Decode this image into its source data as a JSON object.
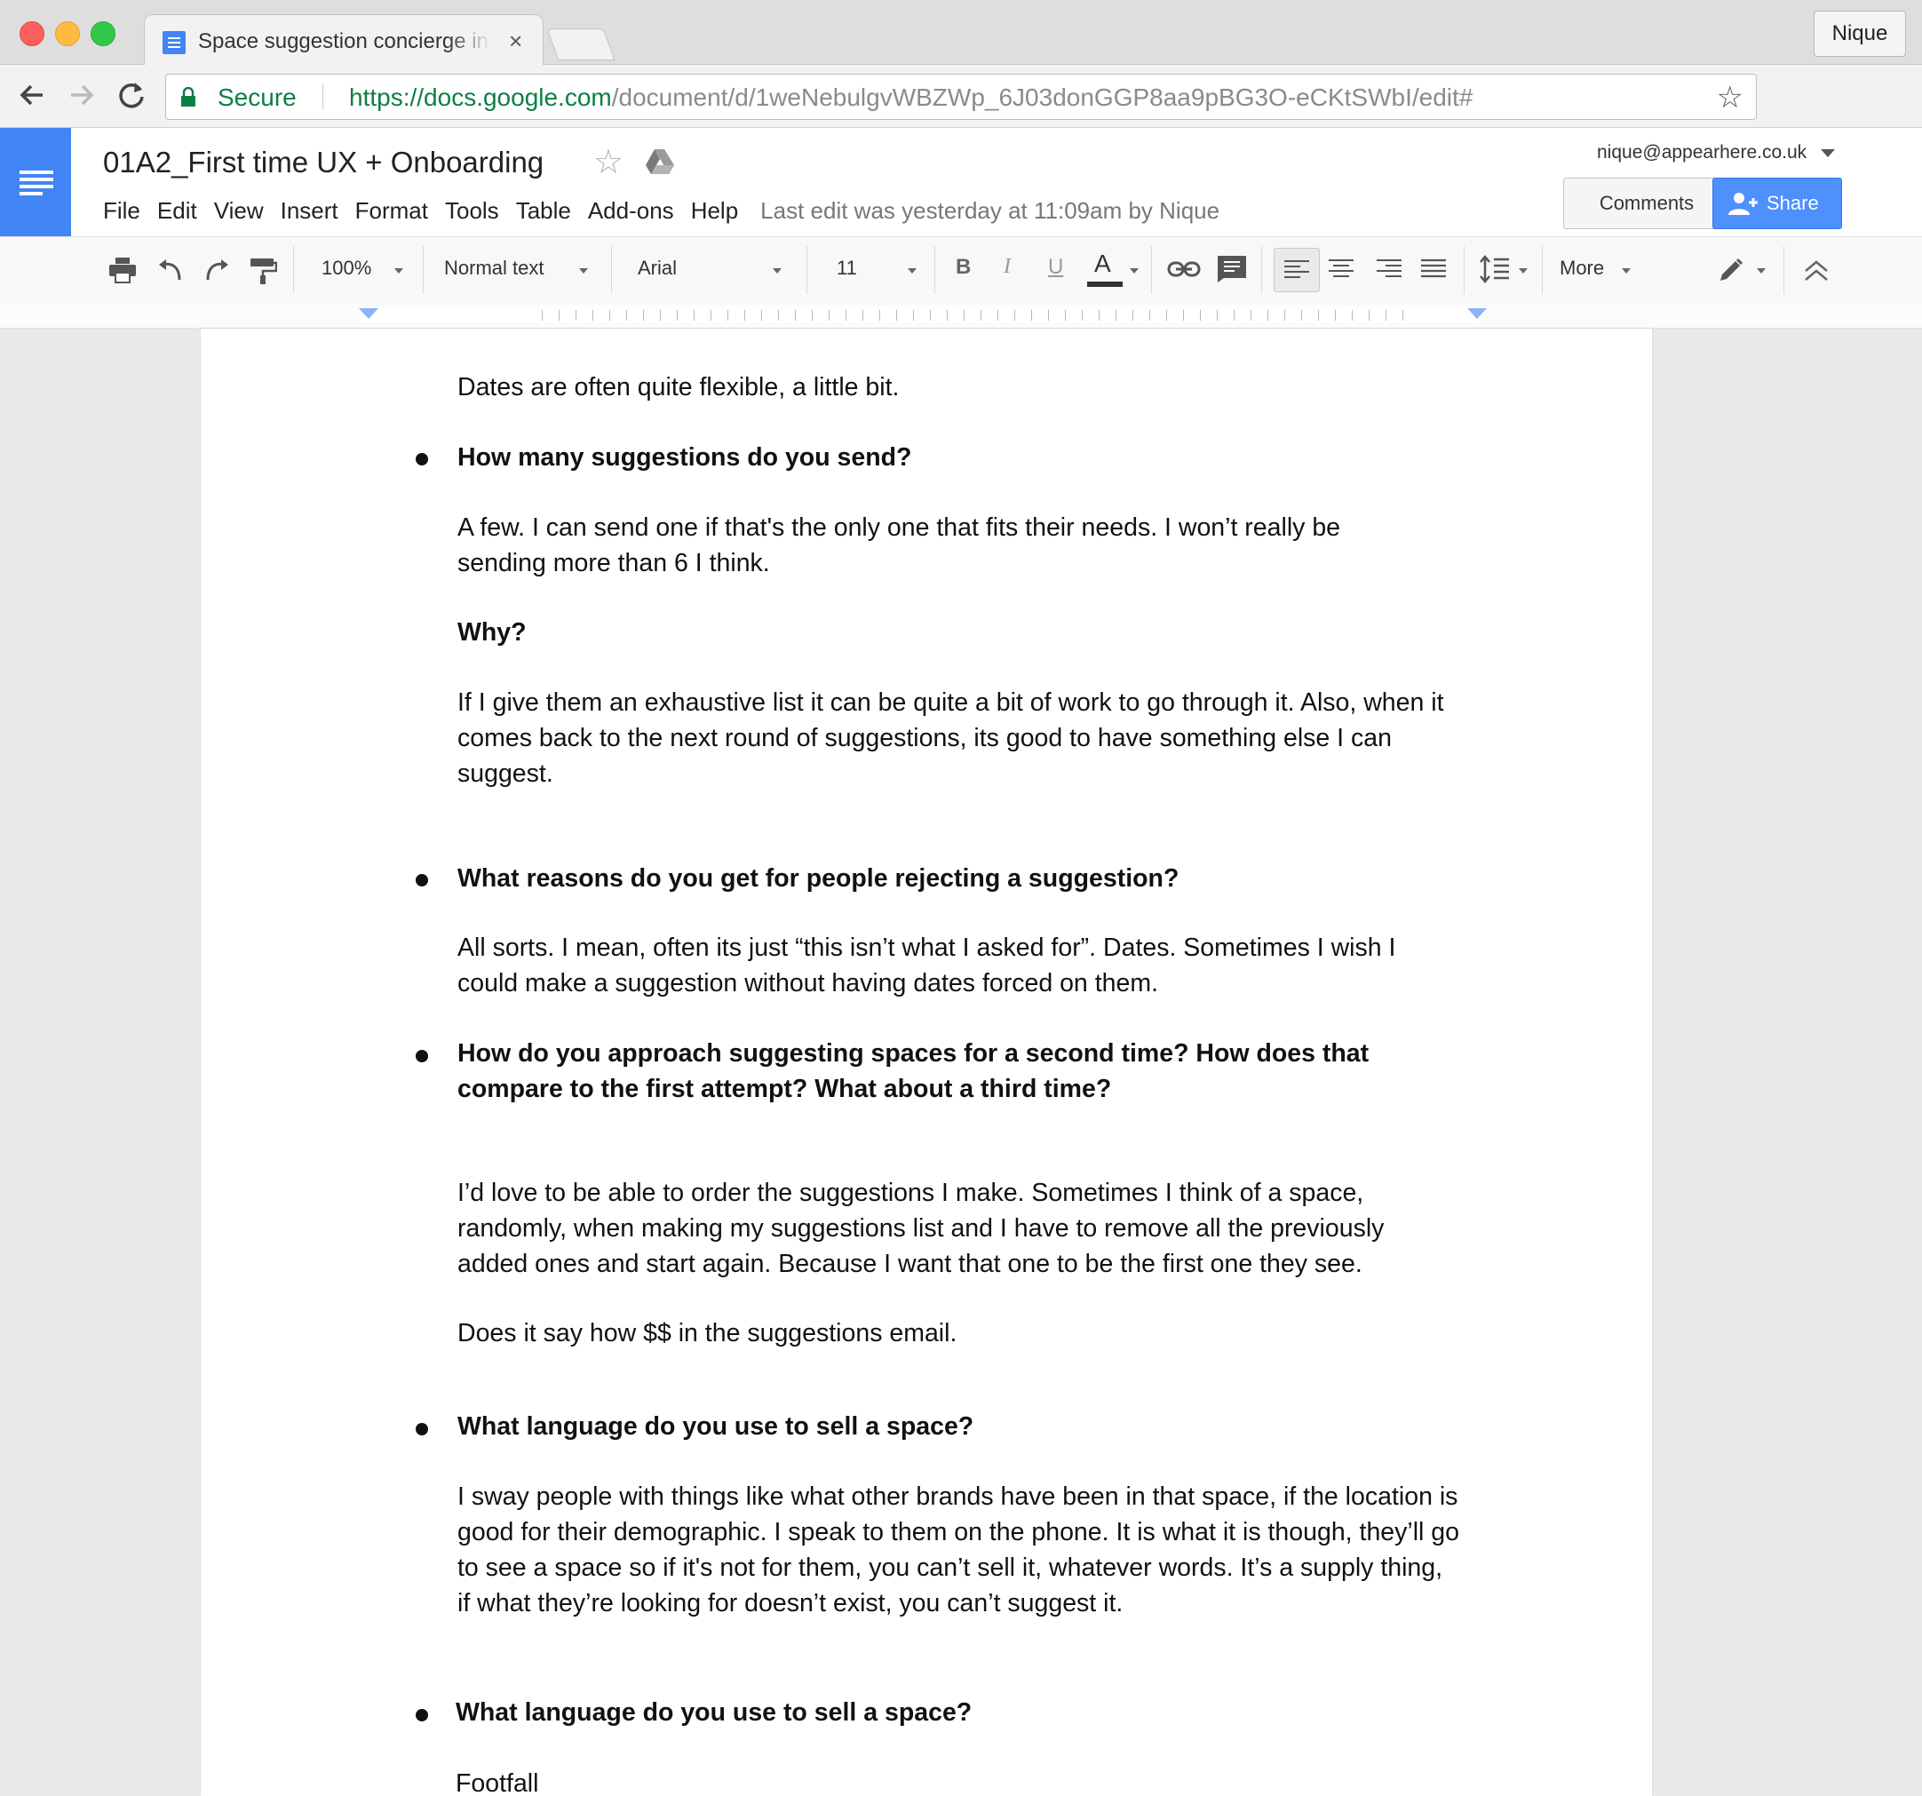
{
  "browser": {
    "tab_title": "Space suggestion concierge interview",
    "tab_close": "×",
    "profile_name": "Nique",
    "secure_label": "Secure",
    "url_scheme": "https://",
    "url_host": "docs.google.com",
    "url_path": "/document/d/1weNebulgvWBZWp_6J03donGGP8aa9pBG3O-eCKtSWbI/edit#"
  },
  "docs": {
    "title": "01A2_First time UX + Onboarding",
    "menus": [
      "File",
      "Edit",
      "View",
      "Insert",
      "Format",
      "Tools",
      "Table",
      "Add-ons",
      "Help"
    ],
    "last_edit": "Last edit was yesterday at 11:09am by Nique",
    "account": "nique@appearhere.co.uk",
    "comments_label": "Comments",
    "share_label": "Share"
  },
  "toolbar": {
    "zoom": "100%",
    "style": "Normal text",
    "font": "Arial",
    "size": "11",
    "bold": "B",
    "italic": "I",
    "underline": "U",
    "text_color": "A",
    "more": "More"
  },
  "document": {
    "paragraphs": [
      "Dates are often quite flexible, a little bit.",
      "How many suggestions do you send?",
      "A few.  I can send one if that's the only one that fits their needs.  I won’t really be sending more than 6 I think.",
      "Why?",
      "If I give them an exhaustive list it can be quite a bit of work to go through it.  Also, when it comes back to the next round of suggestions, its good to have something else I can suggest.",
      "What reasons do you get for people rejecting a suggestion?",
      "All sorts.  I mean, often its just “this isn’t what I asked for”.  Dates.  Sometimes I wish I could make a suggestion without having dates forced on them.",
      "How do you approach suggesting spaces for a second time? How does that compare to the first attempt? What about a third time?",
      "I’d love to be able to order the suggestions I make.  Sometimes I think of a space, randomly, when making my suggestions list and I have to remove all the previously added ones and start again.  Because I want that one to be the first one they see.",
      "Does it say how $$ in the suggestions email.",
      "What language do you use to sell a space?",
      "I sway people with things like what other brands have been in that space, if the location is good for their demographic.  I speak to them on the phone.  It is what it is though, they’ll go to see a space so if it's not for them, you can’t sell it, whatever words.  It’s a supply thing, if what they’re looking for doesn’t exist, you can’t suggest it.",
      "What language do you use to sell a space?",
      "Footfall"
    ]
  },
  "colors": {
    "docs_blue": "#4285f4",
    "share_blue": "#4d90fe",
    "secure_green": "#0b8043"
  }
}
